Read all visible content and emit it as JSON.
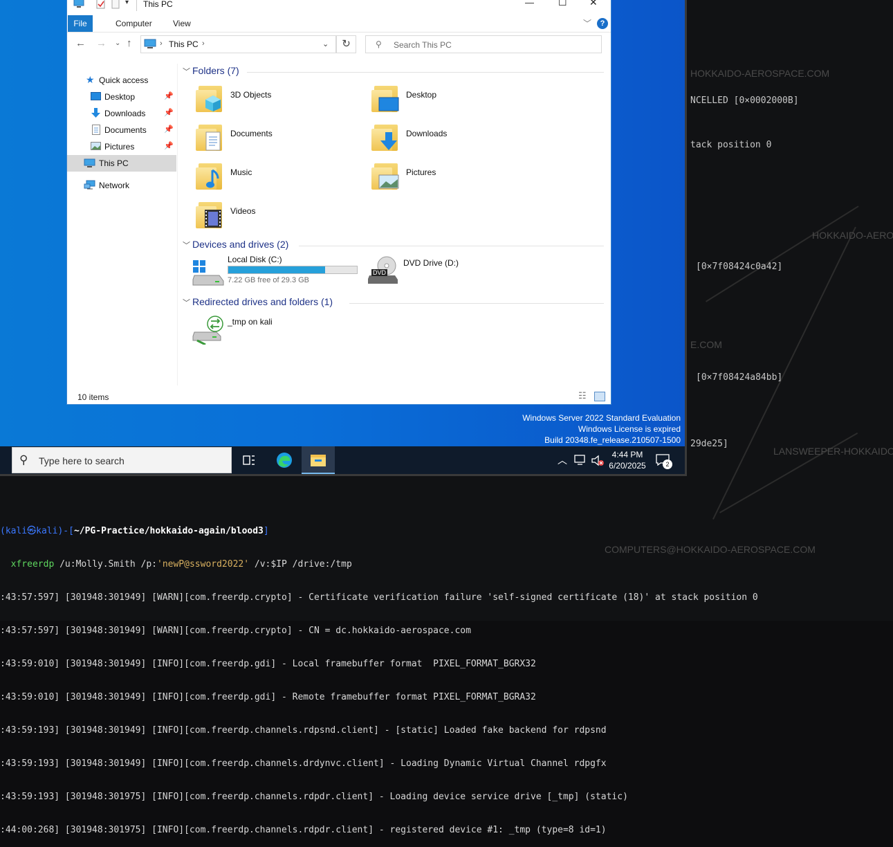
{
  "explorer": {
    "title": "This PC",
    "window_controls": {
      "minimize": "—",
      "maximize": "☐",
      "close": "✕"
    },
    "ribbon_tabs": [
      "File",
      "Computer",
      "View"
    ],
    "address": {
      "icon": "computer-icon",
      "crumbs": [
        "This PC"
      ]
    },
    "search_placeholder": "Search This PC",
    "nav": {
      "quick_access": "Quick access",
      "items": [
        "Desktop",
        "Downloads",
        "Documents",
        "Pictures"
      ],
      "this_pc": "This PC",
      "network": "Network"
    },
    "sections": {
      "folders": "Folders (7)",
      "devices": "Devices and drives (2)",
      "redirected": "Redirected drives and folders (1)"
    },
    "folders": [
      "3D Objects",
      "Desktop",
      "Documents",
      "Downloads",
      "Music",
      "Pictures",
      "Videos"
    ],
    "drives": {
      "local": {
        "name": "Local Disk (C:)",
        "free_text": "7.22 GB free of 29.3 GB",
        "used_fraction": 0.754
      },
      "dvd": {
        "name": "DVD Drive (D:)",
        "badge": "DVD"
      }
    },
    "redirected": {
      "name": "_tmp on kali"
    },
    "status": "10 items"
  },
  "watermark": {
    "line1": "Windows Server 2022 Standard Evaluation",
    "line2": "Windows License is expired",
    "line3": "Build 20348.fe_release.210507-1500"
  },
  "taskbar": {
    "search_placeholder": "Type here to search",
    "time": "4:44 PM",
    "date": "6/20/2025",
    "notification_count": "2"
  },
  "terminal_right": [
    "NCELLED [0×0002000B]",
    "tack position 0",
    "[0×7f08424c0a42]",
    "[0×7f08424a84bb]",
    "29de25]"
  ],
  "bloodhound_labels": [
    "HOKKAIDO-AEROSPACE.COM",
    "HOKKAIDO-AEROS",
    "E.COM",
    "LANSWEEPER-HOKKAIDO-A",
    "COMPUTERS@HOKKAIDO-AEROSPACE.COM"
  ],
  "terminal": {
    "prompt_user": "kali",
    "prompt_at": "㉿",
    "prompt_host": "kali",
    "prompt_path": "~/PG-Practice/hokkaido-again/blood3",
    "cmd": "xfreerdp",
    "cmd_args1": " /u:Molly.Smith /p:",
    "cmd_pass": "'newP@ssword2022'",
    "cmd_args2": " /v:$IP /drive:/tmp",
    "lines": [
      ":43:57:597] [301948:301949] [WARN][com.freerdp.crypto] - Certificate verification failure 'self-signed certificate (18)' at stack position 0",
      ":43:57:597] [301948:301949] [WARN][com.freerdp.crypto] - CN = dc.hokkaido-aerospace.com",
      ":43:59:010] [301948:301949] [INFO][com.freerdp.gdi] - Local framebuffer format  PIXEL_FORMAT_BGRX32",
      ":43:59:010] [301948:301949] [INFO][com.freerdp.gdi] - Remote framebuffer format PIXEL_FORMAT_BGRA32",
      ":43:59:193] [301948:301949] [INFO][com.freerdp.channels.rdpsnd.client] - [static] Loaded fake backend for rdpsnd",
      ":43:59:193] [301948:301949] [INFO][com.freerdp.channels.drdynvc.client] - Loading Dynamic Virtual Channel rdpgfx",
      ":43:59:193] [301948:301975] [INFO][com.freerdp.channels.rdpdr.client] - Loading device service drive [_tmp] (static)",
      ":44:00:268] [301948:301975] [INFO][com.freerdp.channels.rdpdr.client] - registered device #1: _tmp (type=8 id=1)"
    ]
  }
}
